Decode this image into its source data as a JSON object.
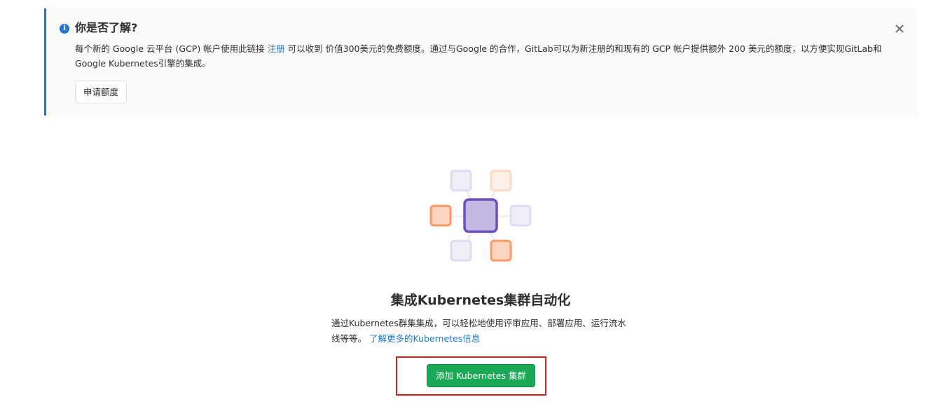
{
  "promo_alert": {
    "title": "你是否了解?",
    "body_before_link": "每个新的 Google 云平台 (GCP) 帐户使用此链接 ",
    "signup_link": "注册",
    "body_after_link": " 可以收到 价值300美元的免费额度。通过与Google 的合作，GitLab可以为新注册的和现有的 GCP 帐户提供额外 200 美元的额度，以方便实现GitLab和 Google Kubernetes引擎的集成。",
    "apply_button": "申请额度",
    "colors": {
      "accent": "#1f78d1",
      "background": "#fafafa"
    }
  },
  "empty_state": {
    "title": "集成Kubernetes集群自动化",
    "description": "通过Kubernetes群集集成，可以轻松地使用评审应用、部署应用、运行流水线等等。 ",
    "learn_more_link": "了解更多的Kubernetes信息",
    "add_cluster_button": "添加 Kubernetes 集群",
    "colors": {
      "primary": "#1aaa55",
      "highlight": "#d81e1e",
      "purple": "#6b4fbb",
      "orange": "#fc9867"
    }
  },
  "icons": {
    "info": "info-circle-icon",
    "close": "close-icon",
    "illustration": "kubernetes-cluster-illustration"
  }
}
